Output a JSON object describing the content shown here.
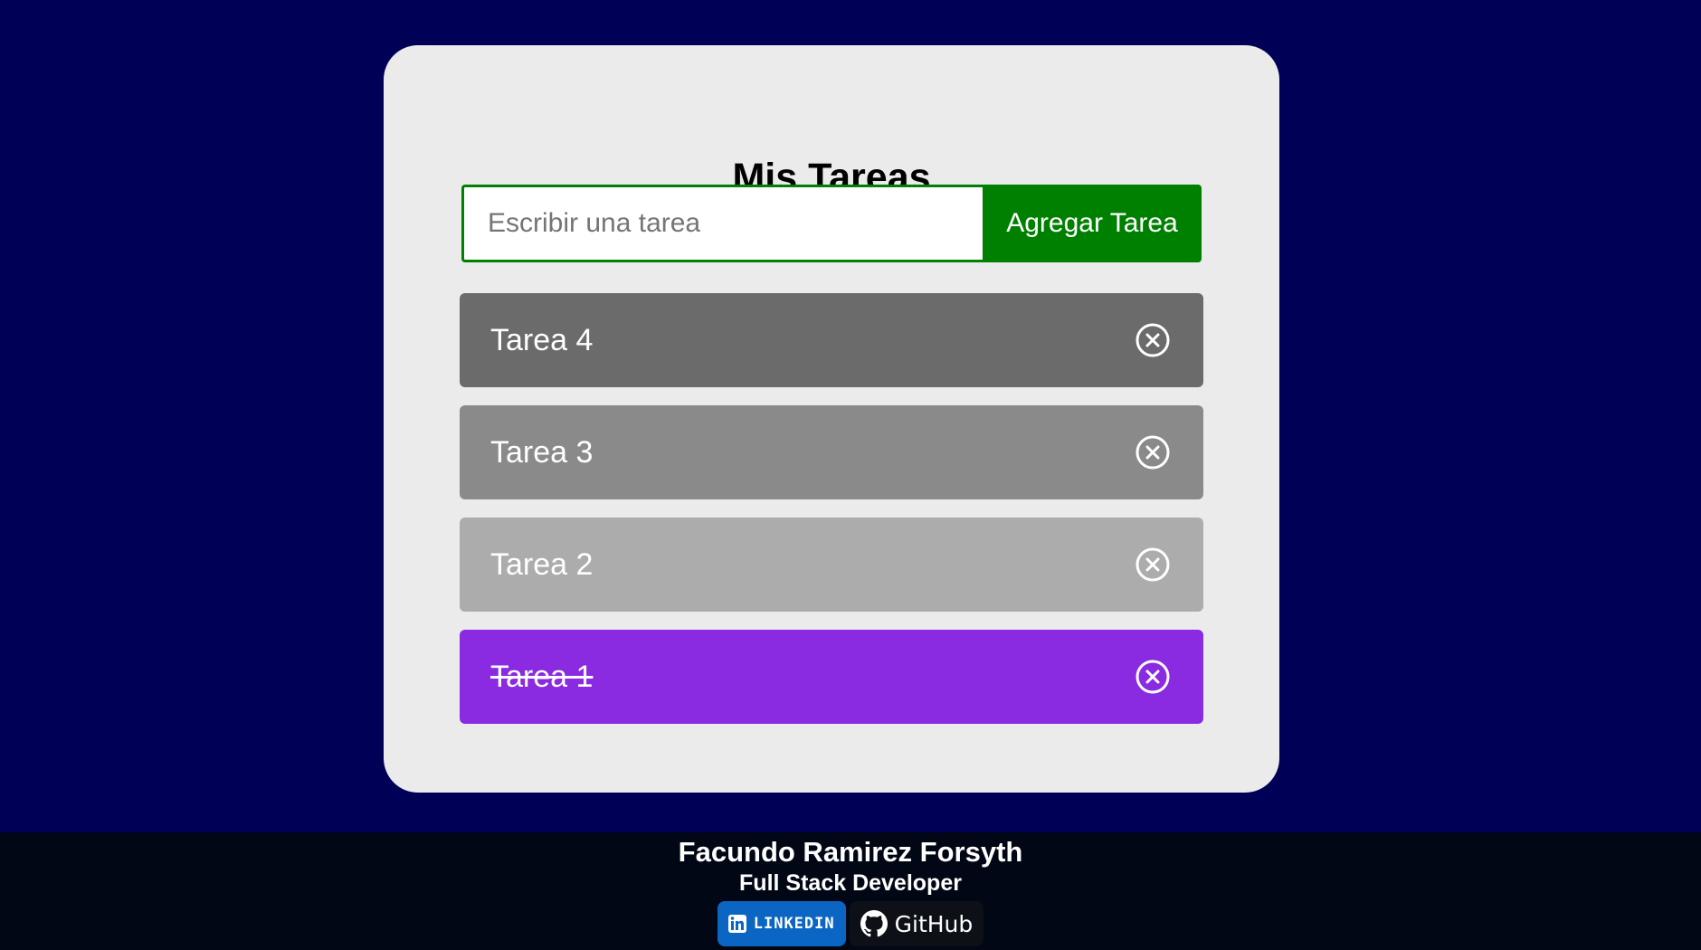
{
  "app": {
    "title": "Mis Tareas"
  },
  "form": {
    "placeholder": "Escribir una tarea",
    "value": "",
    "add_button_label": "Agregar Tarea"
  },
  "tasks": [
    {
      "label": "Tarea 4",
      "completed": false,
      "color": "#6b6b6b",
      "delete_icon": "close-circle-icon"
    },
    {
      "label": "Tarea 3",
      "completed": false,
      "color": "#8a8a8a",
      "delete_icon": "close-circle-icon"
    },
    {
      "label": "Tarea 2",
      "completed": false,
      "color": "#acacac",
      "delete_icon": "close-circle-icon"
    },
    {
      "label": "Tarea 1",
      "completed": true,
      "color": "#8a2be2",
      "delete_icon": "close-circle-icon"
    }
  ],
  "footer": {
    "name": "Facundo Ramirez Forsyth",
    "role": "Full Stack Developer",
    "linkedin_label": "LINKEDIN",
    "github_label": "GitHub"
  },
  "colors": {
    "background": "#000057",
    "card": "#ebebeb",
    "accent": "#008000",
    "footer": "#010714",
    "linkedin": "#0a66c2"
  }
}
